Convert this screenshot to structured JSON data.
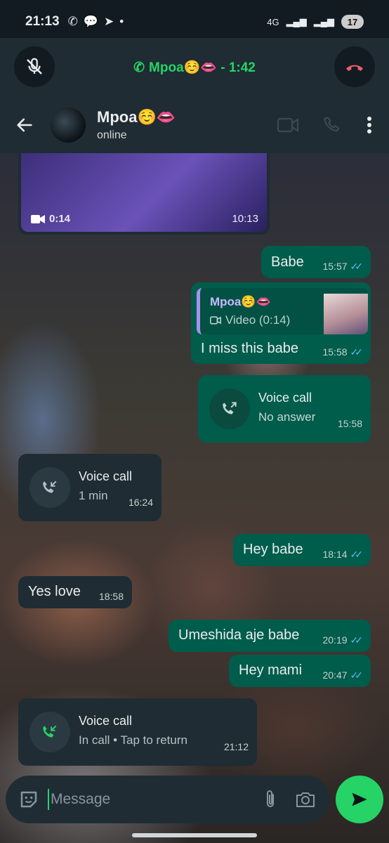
{
  "status_bar": {
    "time": "21:13",
    "network": "4G",
    "battery": "17"
  },
  "ongoing_call": {
    "label": "Mpoa☺️👄 - 1:42"
  },
  "header": {
    "contact_name": "Mpoa☺️👄",
    "status": "online"
  },
  "messages": {
    "video": {
      "duration": "0:14",
      "time": "10:13"
    },
    "m1": {
      "text": "Babe",
      "time": "15:57"
    },
    "m2": {
      "quote_name": "Mpoa☺️👄",
      "quote_text": "Video (0:14)",
      "text": "I miss this babe",
      "time": "15:58"
    },
    "call1": {
      "title": "Voice call",
      "sub": "No answer",
      "time": "15:58"
    },
    "call2": {
      "title": "Voice call",
      "sub": "1 min",
      "time": "16:24"
    },
    "m3": {
      "text": "Hey babe",
      "time": "18:14"
    },
    "m4": {
      "text": "Yes love",
      "time": "18:58"
    },
    "m5": {
      "text": "Umeshida aje babe",
      "time": "20:19"
    },
    "m6": {
      "text": "Hey mami",
      "time": "20:47"
    },
    "call3": {
      "title": "Voice call",
      "sub": "In call • Tap to return",
      "time": "21:12"
    }
  },
  "input": {
    "placeholder": "Message"
  },
  "colors": {
    "accent": "#25d366",
    "outgoing_bubble": "#005c4b",
    "incoming_bubble": "#1f2c33",
    "read_ticks": "#53bdeb",
    "end_call": "#f15c6d"
  }
}
